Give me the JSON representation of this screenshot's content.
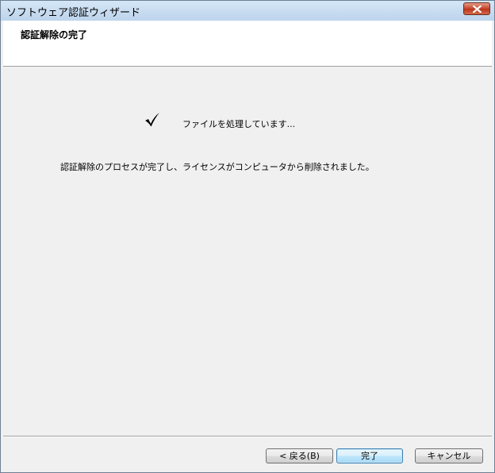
{
  "window": {
    "title": "ソフトウェア認証ウィザード"
  },
  "header": {
    "title": "認証解除の完了"
  },
  "content": {
    "status_text": "ファイルを処理しています...",
    "message": "認証解除のプロセスが完了し、ライセンスがコンピュータから削除されました。"
  },
  "buttons": {
    "back": "< 戻る(B)",
    "finish": "完了",
    "cancel": "キャンセル"
  },
  "icons": {
    "status": "checkmark-icon",
    "close": "close-icon"
  },
  "colors": {
    "close_button": "#c4452c",
    "title_bar": "#c9ddf1",
    "dialog_background": "#f0f0f0"
  }
}
